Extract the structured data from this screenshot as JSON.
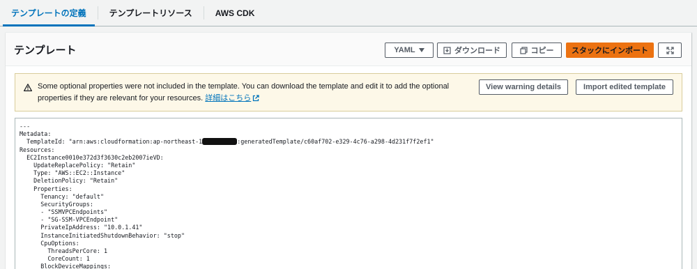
{
  "tabs": [
    {
      "label": "テンプレートの定義",
      "active": true
    },
    {
      "label": "テンプレートリソース",
      "active": false
    },
    {
      "label": "AWS CDK",
      "active": false
    }
  ],
  "panel": {
    "title": "テンプレート",
    "format_select": "YAML",
    "download_label": "ダウンロード",
    "copy_label": "コピー",
    "import_label": "スタックにインポート"
  },
  "warning": {
    "text": "Some optional properties were not included in the template. You can download the template and edit it to add the optional properties if they are relevant for your resources.",
    "link_label": "詳細はこちら",
    "view_details_label": "View warning details",
    "import_edited_label": "Import edited template"
  },
  "code_lines": {
    "l0": "---",
    "l1": "Metadata:",
    "l2a": "  TemplateId: \"arn:aws:cloudformation:ap-northeast-1",
    "l2b": ":generatedTemplate/c60af702-e329-4c76-a298-4d231f7f2ef1\"",
    "l3": "Resources:",
    "l4": "  EC2Instance0010e372d3f3630c2eb2007ieVD:",
    "l5": "    UpdateReplacePolicy: \"Retain\"",
    "l6": "    Type: \"AWS::EC2::Instance\"",
    "l7": "    DeletionPolicy: \"Retain\"",
    "l8": "    Properties:",
    "l9": "      Tenancy: \"default\"",
    "l10": "      SecurityGroups:",
    "l11": "      - \"SSMVPCEndpoints\"",
    "l12": "      - \"SG-SSM-VPCEndpoint\"",
    "l13": "      PrivateIpAddress: \"10.0.1.41\"",
    "l14": "      InstanceInitiatedShutdownBehavior: \"stop\"",
    "l15": "      CpuOptions:",
    "l16": "        ThreadsPerCore: 1",
    "l17": "        CoreCount: 1",
    "l18": "      BlockDeviceMappings:"
  },
  "colors": {
    "accent": "#0073bb",
    "primary_button": "#ec7211",
    "warning_bg": "#fdf8e8"
  },
  "icons": [
    "caret-down-icon",
    "download-icon",
    "copy-icon",
    "fullscreen-icon",
    "warning-icon",
    "external-link-icon"
  ]
}
